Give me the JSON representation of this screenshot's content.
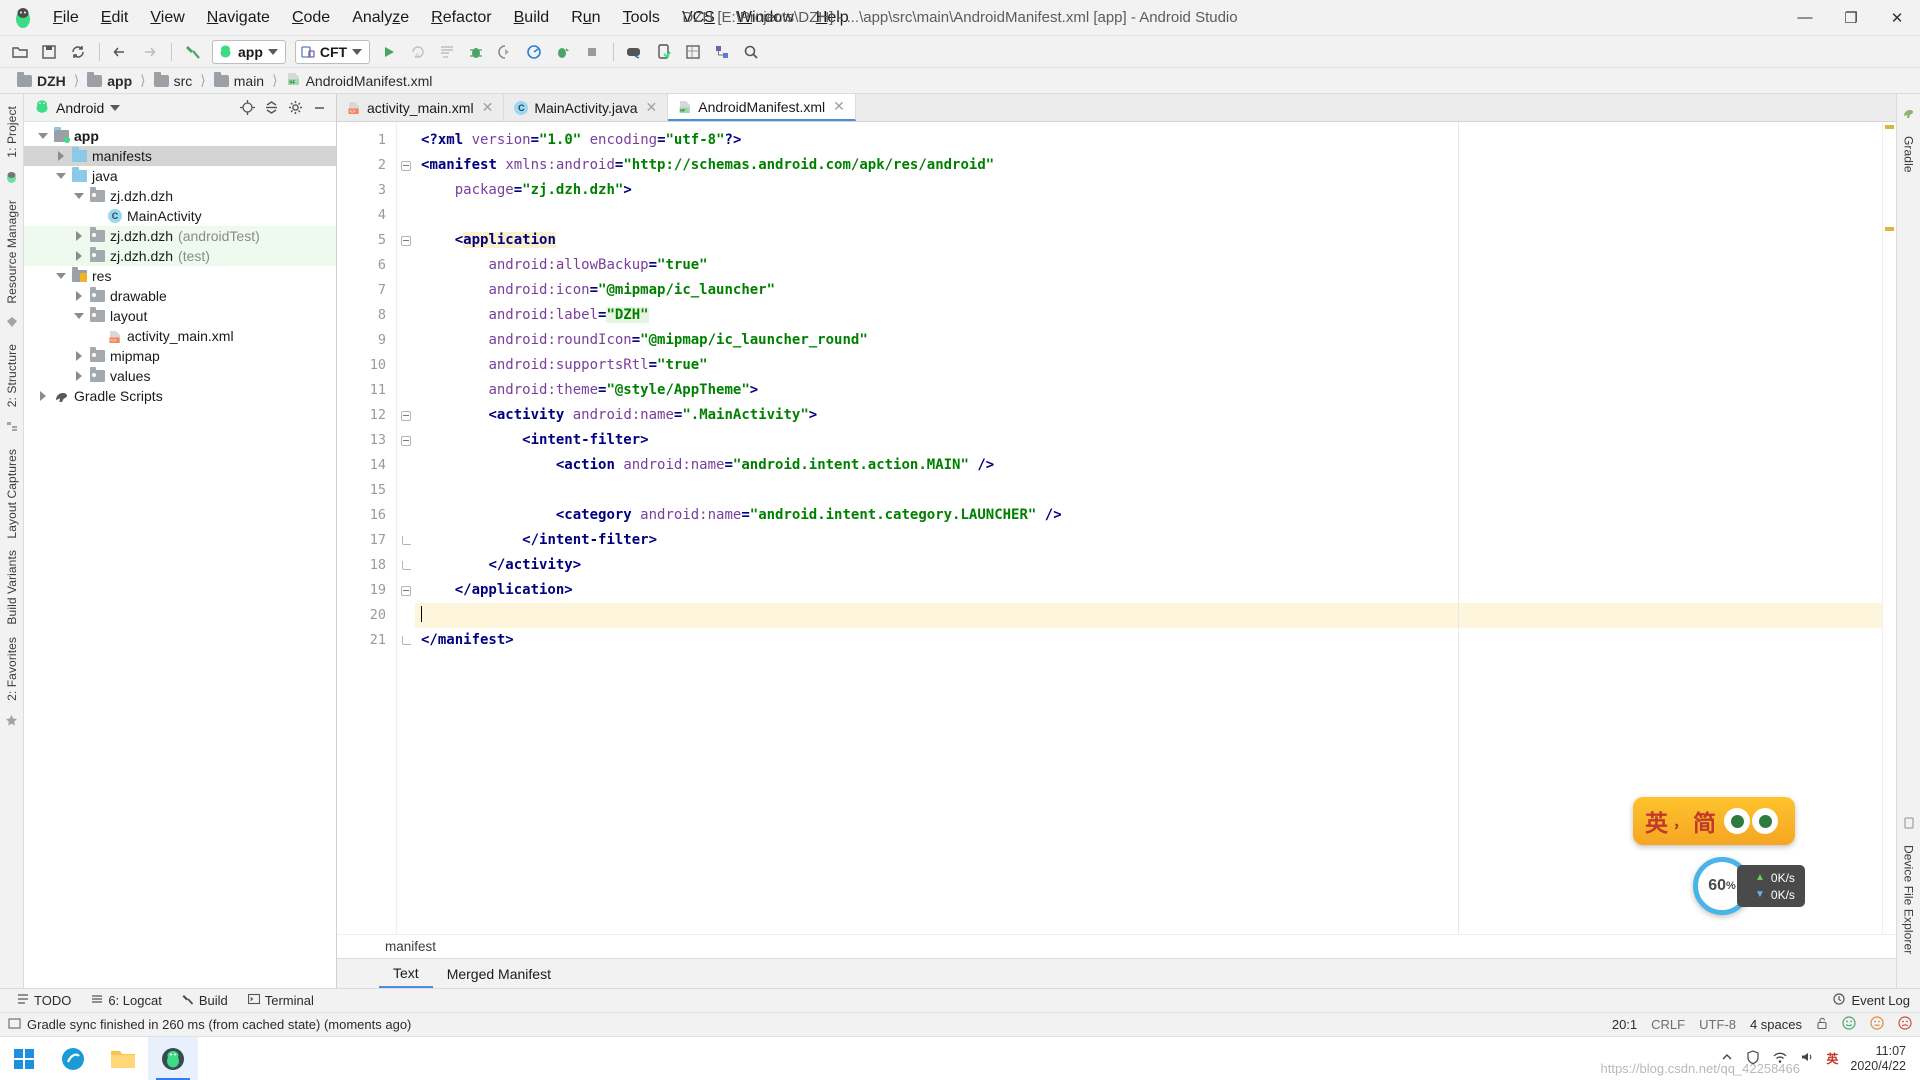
{
  "window": {
    "title": "DZH [E:\\Projects\\DZH] - ...\\app\\src\\main\\AndroidManifest.xml [app] - Android Studio",
    "minimize": "—",
    "maximize": "❐",
    "close": "✕"
  },
  "menu": [
    {
      "label": "File"
    },
    {
      "label": "Edit"
    },
    {
      "label": "View"
    },
    {
      "label": "Navigate"
    },
    {
      "label": "Code"
    },
    {
      "label": "Analyze"
    },
    {
      "label": "Refactor"
    },
    {
      "label": "Build"
    },
    {
      "label": "Run"
    },
    {
      "label": "Tools"
    },
    {
      "label": "VCS"
    },
    {
      "label": "Window"
    },
    {
      "label": "Help"
    }
  ],
  "toolbar": {
    "module_selector": "app",
    "device_selector": "CFT",
    "icons": [
      "open-folder-icon",
      "save-all-icon",
      "sync-project-icon",
      "back-icon",
      "forward-icon",
      "build-hammer-icon",
      "run-icon",
      "apply-changes-icon",
      "apply-code-changes-icon",
      "debug-icon",
      "attach-debugger-icon",
      "profiler-icon",
      "run-coverage-icon",
      "stop-icon",
      "avd-manager-icon",
      "sdk-manager-icon",
      "layout-inspector-icon",
      "project-structure-icon",
      "search-icon"
    ]
  },
  "breadcrumb": [
    {
      "label": "DZH",
      "icon": "project-icon",
      "bold": true
    },
    {
      "label": "app",
      "icon": "module-icon",
      "bold": true
    },
    {
      "label": "src",
      "icon": "folder-icon",
      "bold": false
    },
    {
      "label": "main",
      "icon": "folder-icon",
      "bold": false
    },
    {
      "label": "AndroidManifest.xml",
      "icon": "manifest-file-icon",
      "bold": false
    }
  ],
  "left_rail": [
    {
      "label": "1: Project"
    },
    {
      "label": "Resource Manager"
    },
    {
      "label": "2: Structure"
    },
    {
      "label": "Layout Captures"
    },
    {
      "label": "Build Variants"
    },
    {
      "label": "2: Favorites"
    }
  ],
  "right_rail": [
    {
      "label": "Gradle"
    },
    {
      "label": "Device File Explorer"
    }
  ],
  "project_panel": {
    "view_selector": "Android",
    "actions": [
      "locate-icon",
      "collapse-all-icon",
      "settings-gear-icon",
      "hide-icon"
    ],
    "tree": [
      {
        "label": "app",
        "indent": 0,
        "twisty": "open",
        "icon": "module-icon",
        "bold": true,
        "state": "normal",
        "suffix": ""
      },
      {
        "label": "manifests",
        "indent": 1,
        "twisty": "closed",
        "icon": "folder-blue-icon",
        "bold": false,
        "state": "selected",
        "suffix": ""
      },
      {
        "label": "java",
        "indent": 1,
        "twisty": "open",
        "icon": "folder-blue-icon",
        "bold": false,
        "state": "normal",
        "suffix": ""
      },
      {
        "label": "zj.dzh.dzh",
        "indent": 2,
        "twisty": "open",
        "icon": "package-icon",
        "bold": false,
        "state": "normal",
        "suffix": ""
      },
      {
        "label": "MainActivity",
        "indent": 3,
        "twisty": "none",
        "icon": "class-icon",
        "bold": false,
        "state": "normal",
        "suffix": ""
      },
      {
        "label": "zj.dzh.dzh",
        "indent": 2,
        "twisty": "closed",
        "icon": "package-icon",
        "bold": false,
        "state": "test",
        "suffix": "(androidTest)"
      },
      {
        "label": "zj.dzh.dzh",
        "indent": 2,
        "twisty": "closed",
        "icon": "package-icon",
        "bold": false,
        "state": "test",
        "suffix": "(test)"
      },
      {
        "label": "res",
        "indent": 1,
        "twisty": "open",
        "icon": "res-folder-icon",
        "bold": false,
        "state": "normal",
        "suffix": ""
      },
      {
        "label": "drawable",
        "indent": 2,
        "twisty": "closed",
        "icon": "package-icon",
        "bold": false,
        "state": "normal",
        "suffix": ""
      },
      {
        "label": "layout",
        "indent": 2,
        "twisty": "open",
        "icon": "package-icon",
        "bold": false,
        "state": "normal",
        "suffix": ""
      },
      {
        "label": "activity_main.xml",
        "indent": 3,
        "twisty": "none",
        "icon": "xml-layout-icon",
        "bold": false,
        "state": "normal",
        "suffix": ""
      },
      {
        "label": "mipmap",
        "indent": 2,
        "twisty": "closed",
        "icon": "package-icon",
        "bold": false,
        "state": "normal",
        "suffix": ""
      },
      {
        "label": "values",
        "indent": 2,
        "twisty": "closed",
        "icon": "package-icon",
        "bold": false,
        "state": "normal",
        "suffix": ""
      },
      {
        "label": "Gradle Scripts",
        "indent": 0,
        "twisty": "closed",
        "icon": "gradle-icon",
        "bold": false,
        "state": "normal",
        "suffix": ""
      }
    ]
  },
  "editor": {
    "tabs": [
      {
        "label": "activity_main.xml",
        "icon": "xml-layout-icon",
        "active": false,
        "closeable": true
      },
      {
        "label": "MainActivity.java",
        "icon": "class-icon",
        "active": false,
        "closeable": true
      },
      {
        "label": "AndroidManifest.xml",
        "icon": "manifest-file-icon",
        "active": true,
        "closeable": true
      }
    ],
    "breadcrumb_label": "manifest",
    "design_tabs": [
      {
        "label": "Text",
        "active": true
      },
      {
        "label": "Merged Manifest",
        "active": false
      }
    ],
    "line_numbers": [
      1,
      2,
      3,
      4,
      5,
      6,
      7,
      8,
      9,
      10,
      11,
      12,
      13,
      14,
      15,
      16,
      17,
      18,
      19,
      20,
      21
    ],
    "current_line": 20,
    "code_lines": [
      {
        "n": 1,
        "indent": 0,
        "html": "<span class=\"pun\">&lt;?</span><span class=\"k\">xml </span><span class=\"at\">version</span><span class=\"pun\">=</span><span class=\"atv\">\"1.0\"</span> <span class=\"at\">encoding</span><span class=\"pun\">=</span><span class=\"atv\">\"utf-8\"</span><span class=\"pun\">?&gt;</span>"
      },
      {
        "n": 2,
        "indent": 0,
        "html": "<span class=\"pun\">&lt;</span><span class=\"k\">manifest</span> <span class=\"at\">xmlns:android</span><span class=\"pun\">=</span><span class=\"atv\">\"http://schemas.android.com/apk/res/android\"</span>"
      },
      {
        "n": 3,
        "indent": 0,
        "html": "    <span class=\"at\">package</span><span class=\"pun\">=</span><span class=\"atv\">\"zj.dzh.dzh\"</span><span class=\"pun\">&gt;</span>"
      },
      {
        "n": 4,
        "indent": 0,
        "html": ""
      },
      {
        "n": 5,
        "indent": 0,
        "html": "    <span class=\"pun\">&lt;</span><span class=\"k hl-yellow\">application</span>"
      },
      {
        "n": 6,
        "indent": 0,
        "html": "        <span class=\"at\">android:allowBackup</span><span class=\"pun\">=</span><span class=\"atv\">\"true\"</span>"
      },
      {
        "n": 7,
        "indent": 0,
        "html": "        <span class=\"at\">android:icon</span><span class=\"pun\">=</span><span class=\"atv\">\"@mipmap/ic_launcher\"</span>"
      },
      {
        "n": 8,
        "indent": 0,
        "html": "        <span class=\"at\">android:label</span><span class=\"pun\">=</span><span class=\"atv hl-green\">\"DZH\"</span>"
      },
      {
        "n": 9,
        "indent": 0,
        "html": "        <span class=\"at\">android:roundIcon</span><span class=\"pun\">=</span><span class=\"atv\">\"@mipmap/ic_launcher_round\"</span>"
      },
      {
        "n": 10,
        "indent": 0,
        "html": "        <span class=\"at\">android:supportsRtl</span><span class=\"pun\">=</span><span class=\"atv\">\"true\"</span>"
      },
      {
        "n": 11,
        "indent": 0,
        "html": "        <span class=\"at\">android:theme</span><span class=\"pun\">=</span><span class=\"atv\">\"@style/AppTheme\"</span><span class=\"pun\">&gt;</span>"
      },
      {
        "n": 12,
        "indent": 0,
        "html": "        <span class=\"pun\">&lt;</span><span class=\"k\">activity</span> <span class=\"at\">android:name</span><span class=\"pun\">=</span><span class=\"atv\">\".MainActivity\"</span><span class=\"pun\">&gt;</span>"
      },
      {
        "n": 13,
        "indent": 0,
        "html": "            <span class=\"pun\">&lt;</span><span class=\"k\">intent-filter</span><span class=\"pun\">&gt;</span>"
      },
      {
        "n": 14,
        "indent": 0,
        "html": "                <span class=\"pun\">&lt;</span><span class=\"k\">action</span> <span class=\"at\">android:name</span><span class=\"pun\">=</span><span class=\"atv\">\"android.intent.action.MAIN\"</span> <span class=\"pun\">/&gt;</span>"
      },
      {
        "n": 15,
        "indent": 0,
        "html": ""
      },
      {
        "n": 16,
        "indent": 0,
        "html": "                <span class=\"pun\">&lt;</span><span class=\"k\">category</span> <span class=\"at\">android:name</span><span class=\"pun\">=</span><span class=\"atv\">\"android.intent.category.LAUNCHER\"</span> <span class=\"pun\">/&gt;</span>"
      },
      {
        "n": 17,
        "indent": 0,
        "html": "            <span class=\"pun\">&lt;/</span><span class=\"k\">intent-filter</span><span class=\"pun\">&gt;</span>"
      },
      {
        "n": 18,
        "indent": 0,
        "html": "        <span class=\"pun\">&lt;/</span><span class=\"k\">activity</span><span class=\"pun\">&gt;</span>"
      },
      {
        "n": 19,
        "indent": 0,
        "html": "    <span class=\"pun\">&lt;/</span><span class=\"k\">application</span><span class=\"pun\">&gt;</span>"
      },
      {
        "n": 20,
        "indent": 0,
        "html": "<span class=\"caret-bar\"></span>"
      },
      {
        "n": 21,
        "indent": 0,
        "html": "<span class=\"pun\">&lt;/</span><span class=\"k\">manifest</span><span class=\"pun\">&gt;</span>"
      }
    ]
  },
  "bottom_tools": [
    {
      "label": "TODO",
      "icon": "todo-icon"
    },
    {
      "label": "6: Logcat",
      "icon": "logcat-icon"
    },
    {
      "label": "Build",
      "icon": "build-icon"
    },
    {
      "label": "Terminal",
      "icon": "terminal-icon"
    }
  ],
  "bottom_right": {
    "label": "Event Log",
    "icon": "event-log-icon"
  },
  "statusbar": {
    "message": "Gradle sync finished in 260 ms (from cached state) (moments ago)",
    "caret_position": "20:1",
    "line_separator": "CRLF",
    "encoding": "UTF-8",
    "indent": "4 spaces",
    "lock_icon": "unlocked-icon",
    "faces": [
      "smiley-happy-icon",
      "smiley-neutral-icon",
      "smiley-sad-icon"
    ]
  },
  "floating": {
    "ime": {
      "lang": "英",
      "sep": "，",
      "mode": "简",
      "name": "ime-indicator"
    },
    "speed": {
      "percent": "60",
      "upload": "0K/s",
      "download": "0K/s",
      "unit_up": "▲",
      "unit_down": "▼"
    }
  },
  "taskbar": {
    "apps": [
      {
        "name": "start-button"
      },
      {
        "name": "browser-icon"
      },
      {
        "name": "file-explorer-icon"
      },
      {
        "name": "android-studio-icon",
        "active": true
      }
    ],
    "tray_icons": [
      "chevron-up-icon",
      "security-icon",
      "network-icon",
      "volume-icon",
      "ime-icon"
    ],
    "clock_time": "11:07",
    "clock_date": "2020/4/22",
    "watermark": "https://blog.csdn.net/qq_42258466"
  },
  "colors": {
    "accent": "#4a90d9",
    "tag": "#000080",
    "attribute": "#7a3e9d",
    "value": "#008000",
    "highlight_yellow": "#fbf0cd",
    "highlight_green": "#e7f5e0",
    "test_row": "#effaef",
    "selected_row": "#d4d4d4"
  }
}
